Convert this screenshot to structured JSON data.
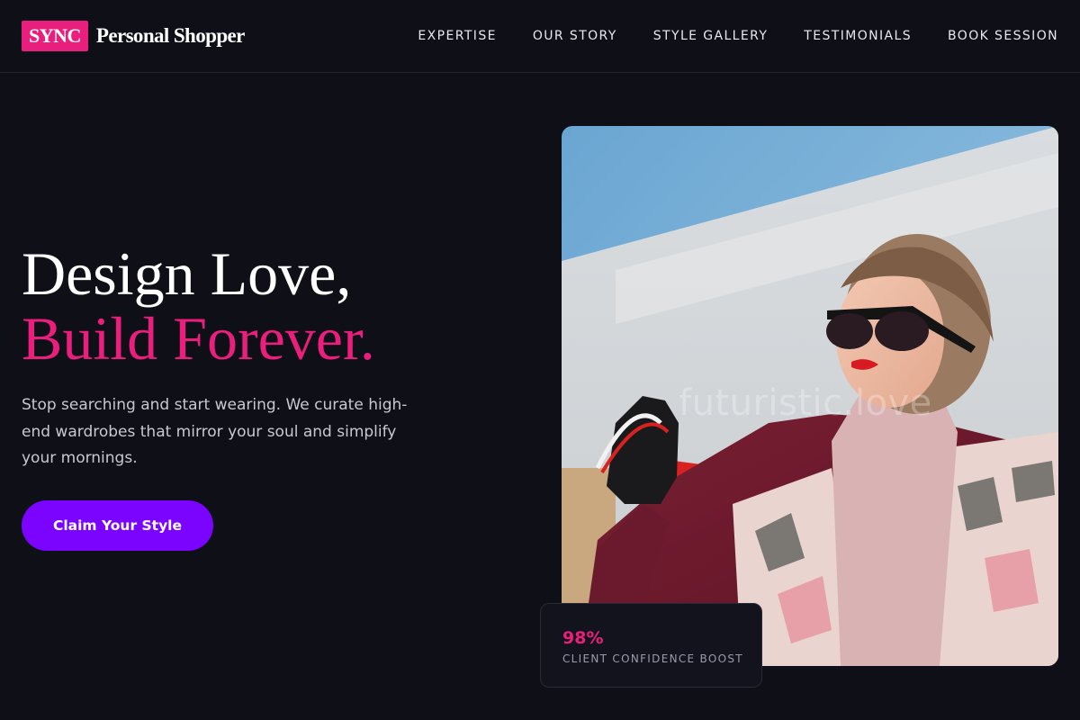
{
  "brand": {
    "badge": "SYNC",
    "name": "Personal Shopper"
  },
  "nav": {
    "items": [
      "EXPERTISE",
      "OUR STORY",
      "STYLE GALLERY",
      "TESTIMONIALS",
      "BOOK SESSION"
    ]
  },
  "hero": {
    "title_line1": "Design Love,",
    "title_line2": "Build Forever.",
    "subtitle": "Stop searching and start wearing. We curate high-end wardrobes that mirror your soul and simplify your mornings.",
    "cta_label": "Claim Your Style"
  },
  "image": {
    "subject": "woman-with-sunglasses-and-shopping-bags-photo",
    "watermark": "futuristic.love"
  },
  "stat": {
    "value": "98%",
    "label": "CLIENT CONFIDENCE BOOST"
  },
  "colors": {
    "background": "#0f0f17",
    "accent_pink": "#ea1e7c",
    "cta_purple": "#7a04ff"
  }
}
